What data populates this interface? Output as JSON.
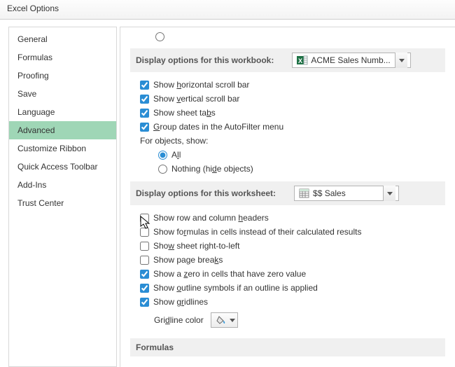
{
  "window": {
    "title": "Excel Options"
  },
  "sidebar": {
    "items": [
      {
        "label": "General"
      },
      {
        "label": "Formulas"
      },
      {
        "label": "Proofing"
      },
      {
        "label": "Save"
      },
      {
        "label": "Language"
      },
      {
        "label": "Advanced"
      },
      {
        "label": "Customize Ribbon"
      },
      {
        "label": "Quick Access Toolbar"
      },
      {
        "label": "Add-Ins"
      },
      {
        "label": "Trust Center"
      }
    ],
    "selected_index": 5
  },
  "workbook_section": {
    "title": "Display options for this workbook:",
    "dropdown_value": "ACME Sales Numb...",
    "options": {
      "hscroll": "Show horizontal scroll bar",
      "vscroll": "Show vertical scroll bar",
      "sheettabs": "Show sheet tabs",
      "groupdates": "Group dates in the AutoFilter menu",
      "objects_label": "For objects, show:",
      "radio_all": "All",
      "radio_nothing": "Nothing (hide objects)"
    }
  },
  "worksheet_section": {
    "title": "Display options for this worksheet:",
    "dropdown_value": "$$ Sales",
    "options": {
      "rowcol": "Show row and column headers",
      "formulas": "Show formulas in cells instead of their calculated results",
      "rtl": "Show sheet right-to-left",
      "pagebreaks": "Show page breaks",
      "zeros": "Show a zero in cells that have zero value",
      "outline": "Show outline symbols if an outline is applied",
      "gridlines": "Show gridlines",
      "gridcolor_label": "Gridline color"
    }
  },
  "formulas_section": {
    "title": "Formulas"
  }
}
